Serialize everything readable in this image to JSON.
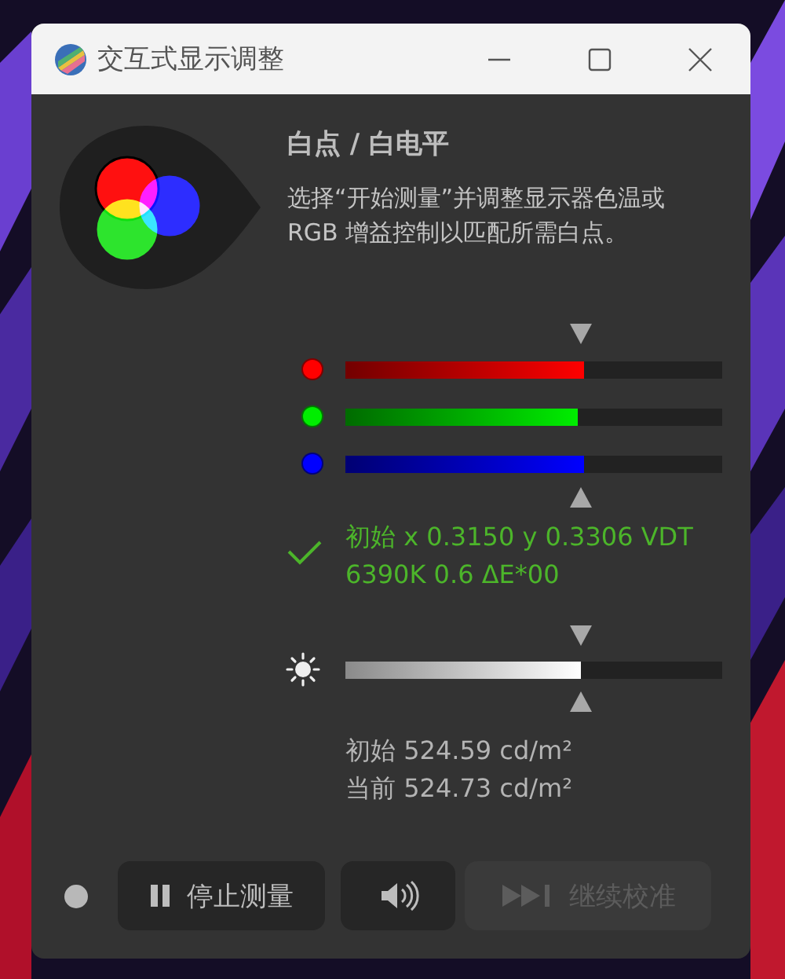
{
  "window": {
    "title": "交互式显示调整"
  },
  "heading": "白点 / 白电平",
  "description": "选择“开始测量”并调整显示器色温或\nRGB 增益控制以匹配所需白点。",
  "rgb_target": {
    "level": 0.625
  },
  "channels": [
    {
      "color": "#ff0000",
      "level": 0.635
    },
    {
      "color": "#00ee00",
      "level": 0.615
    },
    {
      "color": "#0000ff",
      "level": 0.635
    }
  ],
  "status": {
    "ok": true,
    "lines": [
      "初始 x 0.3150 y 0.3306 VDT",
      "6390K 0.6 ΔE*00"
    ]
  },
  "brightness": {
    "level": 0.625,
    "target": {
      "level": 0.625
    }
  },
  "luminance": [
    "初始 524.59 cd/m²",
    "当前 524.73 cd/m²"
  ],
  "buttons": [
    {
      "kind": "stop",
      "label": "停止测量",
      "disabled": false
    },
    {
      "kind": "sound",
      "disabled": false
    },
    {
      "kind": "continue",
      "label": "继续校准",
      "disabled": true
    }
  ]
}
